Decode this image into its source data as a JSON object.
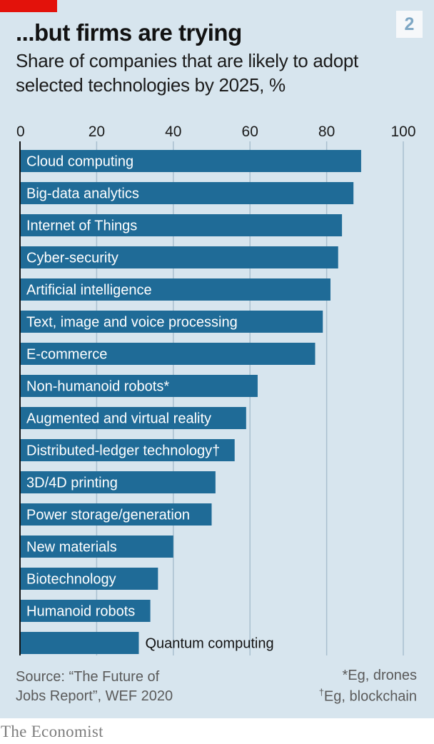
{
  "header": {
    "chart_number": "2",
    "title": "...but firms are trying",
    "subtitle_line1": "Share of companies that are likely to adopt",
    "subtitle_line2": "selected technologies by 2025, %"
  },
  "colors": {
    "bar": "#1f6b97",
    "background": "#d7e5ee",
    "accent_tag": "#e3120b",
    "axis_line": "#121212"
  },
  "chart_data": {
    "type": "bar",
    "orientation": "horizontal",
    "title": "...but firms are trying",
    "subtitle": "Share of companies that are likely to adopt selected technologies by 2025, %",
    "xlim": [
      0,
      100
    ],
    "x_ticks": [
      0,
      20,
      40,
      60,
      80,
      100
    ],
    "grid": true,
    "categories": [
      "Cloud computing",
      "Big-data analytics",
      "Internet of Things",
      "Cyber-security",
      "Artificial intelligence",
      "Text, image and voice processing",
      "E-commerce",
      "Non-humanoid robots*",
      "Augmented and virtual reality",
      "Distributed-ledger technology†",
      "3D/4D printing",
      "Power storage/generation",
      "New materials",
      "Biotechnology",
      "Humanoid robots",
      "Quantum computing"
    ],
    "values": [
      89,
      87,
      84,
      83,
      81,
      79,
      77,
      62,
      59,
      56,
      51,
      50,
      40,
      36,
      34,
      31
    ]
  },
  "footer": {
    "source_line1": "Source: “The Future of",
    "source_line2": "Jobs Report”, WEF 2020",
    "note1": "*Eg, drones",
    "note2_mark": "†",
    "note2": "Eg, blockchain",
    "brand": "The Economist"
  }
}
